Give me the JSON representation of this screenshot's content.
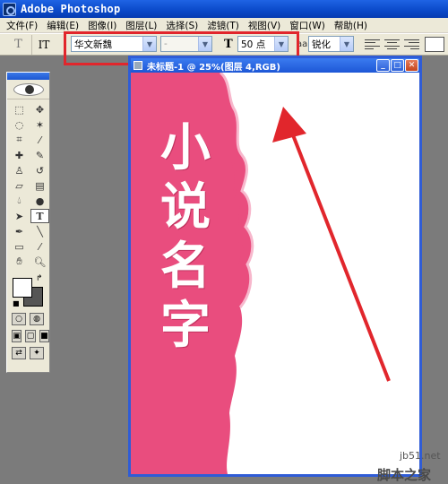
{
  "app": {
    "title": "Adobe Photoshop"
  },
  "menu": [
    "文件(F)",
    "编辑(E)",
    "图像(I)",
    "图层(L)",
    "选择(S)",
    "滤镜(T)",
    "视图(V)",
    "窗口(W)",
    "帮助(H)"
  ],
  "options": {
    "preset_glyph": "T",
    "orient_glyph": "IT",
    "font_family": "华文新魏",
    "font_style": "-",
    "size_glyph": "T",
    "font_size": "50 点",
    "aa_glyph": "aa",
    "antialias": "锐化"
  },
  "document": {
    "title": "未标题-1 @ 25%(图层 4,RGB)",
    "text_chars": [
      "小",
      "说",
      "名",
      "字"
    ],
    "colors": {
      "pink": "#e94d7e",
      "white": "#ffffff"
    }
  },
  "annotation": {
    "box_color": "#e1262c",
    "arrow_color": "#e1262c"
  },
  "watermark": {
    "url": "jb51.net",
    "brand": "脚本之家"
  }
}
